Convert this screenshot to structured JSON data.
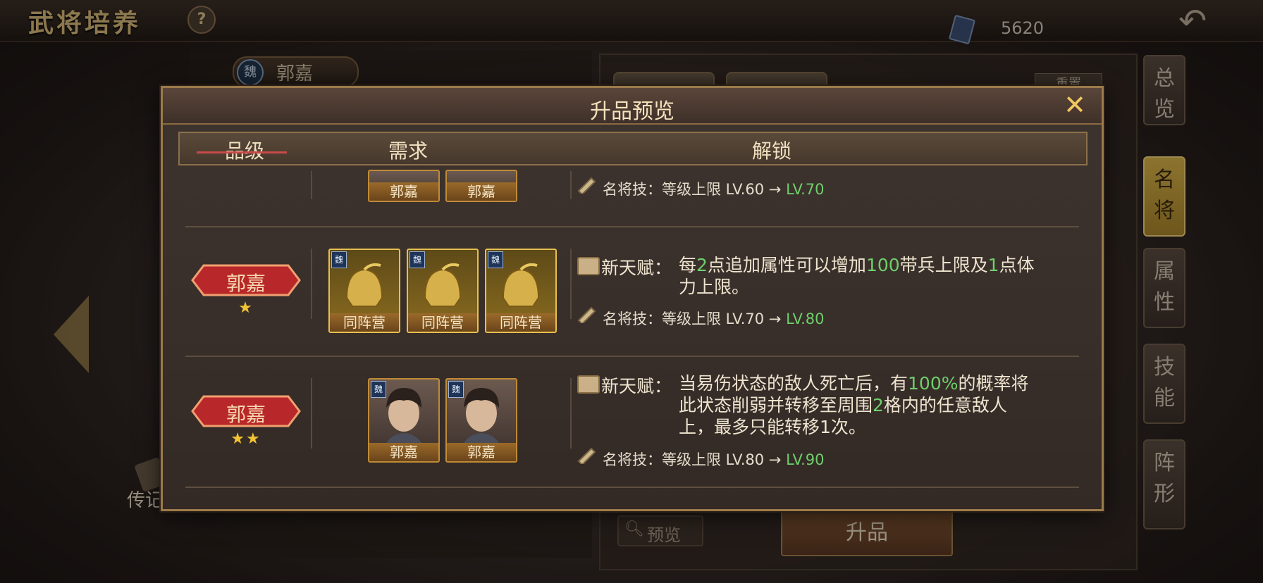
{
  "topbar": {
    "title": "武将培养",
    "help": "?",
    "currency_value": "5620",
    "back_icon": "back-arrow-icon"
  },
  "background": {
    "hero_faction": "魏",
    "hero_name": "郭嘉",
    "reset_label": "重置",
    "scroll_label": "传记",
    "preview_label": "预览",
    "upgrade_label": "升品",
    "side_tabs": [
      {
        "label": "总览",
        "active": false
      },
      {
        "label": "名将",
        "active": true
      },
      {
        "label": "属性",
        "active": false
      },
      {
        "label": "技能",
        "active": false
      },
      {
        "label": "阵形",
        "active": false
      }
    ]
  },
  "modal": {
    "title": "升品预览",
    "close_icon": "close-icon",
    "columns": {
      "grade": "品级",
      "requirement": "需求",
      "unlock": "解锁"
    },
    "rows": [
      {
        "grade_name": "",
        "stars": "",
        "cards": [
          {
            "label": "郭嘉"
          },
          {
            "label": "郭嘉"
          }
        ],
        "talent": null,
        "skill": {
          "prefix": "名将技：等级上限 LV.60 → ",
          "target": "LV.70"
        }
      },
      {
        "grade_name": "郭嘉",
        "stars": "★",
        "cards": [
          {
            "faction": "魏",
            "label": "同阵营"
          },
          {
            "faction": "魏",
            "label": "同阵营"
          },
          {
            "faction": "魏",
            "label": "同阵营"
          }
        ],
        "talent": {
          "label": "新天赋：",
          "parts": [
            "每",
            "2",
            "点追加属性可以增加",
            "100",
            "带兵上限及",
            "1",
            "点体力上限。"
          ]
        },
        "skill": {
          "prefix": "名将技：等级上限 LV.70 → ",
          "target": "LV.80"
        }
      },
      {
        "grade_name": "郭嘉",
        "stars": "★★",
        "cards": [
          {
            "faction": "魏",
            "label": "郭嘉"
          },
          {
            "faction": "魏",
            "label": "郭嘉"
          }
        ],
        "talent": {
          "label": "新天赋：",
          "parts": [
            "当易伤状态的敌人死亡后，有",
            "100%",
            "的概率将此状态削弱并转移至周围",
            "2",
            "格内的任意敌人上，最多只能转移1次。"
          ]
        },
        "skill": {
          "prefix": "名将技：等级上限 LV.80 → ",
          "target": "LV.90"
        }
      }
    ]
  },
  "colors": {
    "highlight": "#6fcf6a",
    "gold": "#f3c433",
    "badge_red": "#b8282a"
  }
}
